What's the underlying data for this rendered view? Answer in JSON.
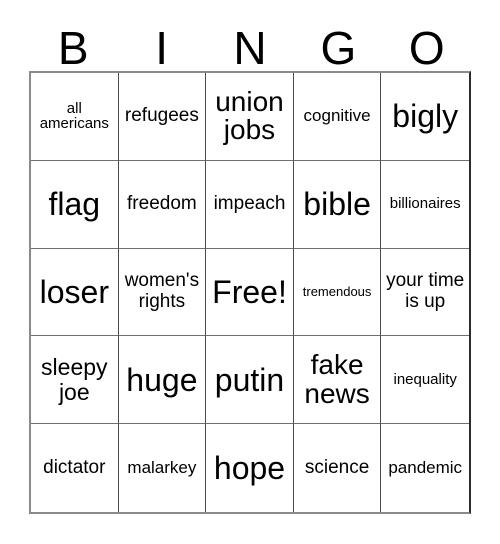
{
  "card": {
    "title": "BINGO",
    "header_letters": [
      "B",
      "I",
      "N",
      "G",
      "O"
    ],
    "free_space_index": 12,
    "colors": {
      "background": "#ffffff",
      "text": "#000000",
      "grid_line": "#4a4a4a",
      "outer_border": "#8a8a8a"
    },
    "columns": 5,
    "rows": 5,
    "cells": [
      {
        "text": "all americans",
        "size": "sz-s"
      },
      {
        "text": "refugees",
        "size": "sz-ml"
      },
      {
        "text": "union jobs",
        "size": "sz-xl"
      },
      {
        "text": "cognitive",
        "size": "sz-m"
      },
      {
        "text": "bigly",
        "size": "sz-xxl"
      },
      {
        "text": "flag",
        "size": "sz-xxl"
      },
      {
        "text": "freedom",
        "size": "sz-ml"
      },
      {
        "text": "impeach",
        "size": "sz-ml"
      },
      {
        "text": "bible",
        "size": "sz-xxl"
      },
      {
        "text": "billionaires",
        "size": "sz-s"
      },
      {
        "text": "loser",
        "size": "sz-xxl"
      },
      {
        "text": "women's rights",
        "size": "sz-ml"
      },
      {
        "text": "Free!",
        "size": "sz-xxl"
      },
      {
        "text": "tremendous",
        "size": "sz-xs"
      },
      {
        "text": "your time is up",
        "size": "sz-ml"
      },
      {
        "text": "sleepy joe",
        "size": "sz-l"
      },
      {
        "text": "huge",
        "size": "sz-xxl"
      },
      {
        "text": "putin",
        "size": "sz-xxl"
      },
      {
        "text": "fake news",
        "size": "sz-xl"
      },
      {
        "text": "inequality",
        "size": "sz-s"
      },
      {
        "text": "dictator",
        "size": "sz-ml"
      },
      {
        "text": "malarkey",
        "size": "sz-m"
      },
      {
        "text": "hope",
        "size": "sz-xxl"
      },
      {
        "text": "science",
        "size": "sz-ml"
      },
      {
        "text": "pandemic",
        "size": "sz-m"
      }
    ]
  }
}
